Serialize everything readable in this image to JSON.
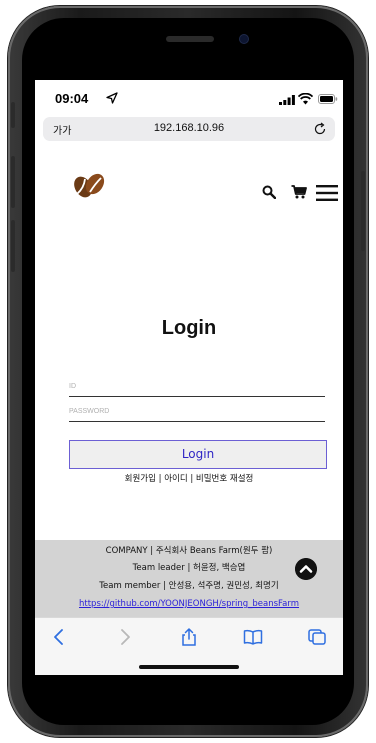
{
  "status_bar": {
    "time": "09:04",
    "location_icon": "location-arrow-icon",
    "signal_icon": "cellular-signal-icon",
    "wifi_icon": "wifi-icon",
    "battery_icon": "battery-icon"
  },
  "browser": {
    "text_size_label": "가가",
    "url": "192.168.10.96",
    "reload_icon": "reload-icon"
  },
  "header": {
    "logo": "coffee-bean-logo",
    "icons": [
      "search-icon",
      "cart-icon",
      "hamburger-menu-icon"
    ]
  },
  "login": {
    "title": "Login",
    "id_placeholder": "ID",
    "password_placeholder": "PASSWORD",
    "button_label": "Login",
    "links": "회원가입 | 아이디 | 비밀번호 재설정"
  },
  "footer": {
    "company": "COMPANY | 주식회사 Beans Farm(원두 팜)",
    "team_leader": "Team leader | 허윤정, 백승엽",
    "team_member": "Team member | 안성용, 석주명, 권민성, 최명기",
    "github_link": "https://github.com/YOONJEONGH/spring_beansFarm"
  },
  "toolbar": {
    "icons": [
      "back-icon",
      "forward-icon",
      "share-icon",
      "bookmarks-icon",
      "tabs-icon"
    ]
  },
  "colors": {
    "accent": "#2f25c5",
    "button_border": "#6c5fd4",
    "footer_bg": "#d3d3d3",
    "link": "#2a1fd8"
  }
}
